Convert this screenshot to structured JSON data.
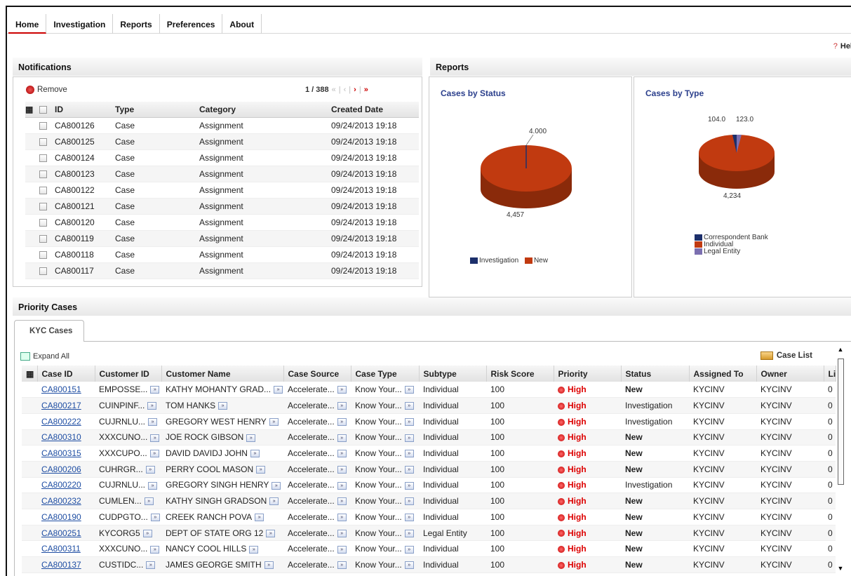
{
  "nav": {
    "tabs": [
      "Home",
      "Investigation",
      "Reports",
      "Preferences",
      "About"
    ],
    "help": "Hel"
  },
  "notifications": {
    "title": "Notifications",
    "remove_label": "Remove",
    "pager": "1 / 388",
    "columns": [
      "ID",
      "Type",
      "Category",
      "Created Date"
    ],
    "rows": [
      [
        "CA800126",
        "Case",
        "Assignment",
        "09/24/2013 19:18"
      ],
      [
        "CA800125",
        "Case",
        "Assignment",
        "09/24/2013 19:18"
      ],
      [
        "CA800124",
        "Case",
        "Assignment",
        "09/24/2013 19:18"
      ],
      [
        "CA800123",
        "Case",
        "Assignment",
        "09/24/2013 19:18"
      ],
      [
        "CA800122",
        "Case",
        "Assignment",
        "09/24/2013 19:18"
      ],
      [
        "CA800121",
        "Case",
        "Assignment",
        "09/24/2013 19:18"
      ],
      [
        "CA800120",
        "Case",
        "Assignment",
        "09/24/2013 19:18"
      ],
      [
        "CA800119",
        "Case",
        "Assignment",
        "09/24/2013 19:18"
      ],
      [
        "CA800118",
        "Case",
        "Assignment",
        "09/24/2013 19:18"
      ],
      [
        "CA800117",
        "Case",
        "Assignment",
        "09/24/2013 19:18"
      ]
    ]
  },
  "reports": {
    "title": "Reports",
    "status_chart": {
      "title": "Cases by Status",
      "labels": [
        "4.000",
        "4,457"
      ],
      "legend": [
        "Investigation",
        "New"
      ]
    },
    "type_chart": {
      "title": "Cases by Type",
      "labels": [
        "104.0",
        "123.0",
        "4,234"
      ],
      "legend": [
        "Correspondent Bank",
        "Individual",
        "Legal Entity"
      ]
    }
  },
  "chart_data": [
    {
      "type": "pie",
      "title": "Cases by Status",
      "categories": [
        "Investigation",
        "New"
      ],
      "values": [
        4,
        4457
      ],
      "colors": [
        "#1c2f6b",
        "#c13a10"
      ],
      "legend": "bottom"
    },
    {
      "type": "pie",
      "title": "Cases by Type",
      "categories": [
        "Correspondent Bank",
        "Individual",
        "Legal Entity"
      ],
      "values": [
        104,
        4234,
        123
      ],
      "colors": [
        "#1c2f6b",
        "#c13a10",
        "#7b6fb0"
      ],
      "legend": "bottom"
    }
  ],
  "priority": {
    "title": "Priority Cases",
    "tab": "KYC Cases",
    "expand_all": "Expand All",
    "case_list": "Case List",
    "columns": [
      "Case ID",
      "Customer ID",
      "Customer Name",
      "Case Source",
      "Case Type",
      "Subtype",
      "Risk Score",
      "Priority",
      "Status",
      "Assigned To",
      "Owner",
      "Li"
    ],
    "rows": [
      [
        "CA800151",
        "EMPOSSE...",
        "KATHY MOHANTY GRAD...",
        "Accelerate...",
        "Know Your...",
        "Individual",
        "100",
        "High",
        "New",
        "KYCINV",
        "KYCINV",
        "0"
      ],
      [
        "CA800217",
        "CUINPINF...",
        "TOM HANKS",
        "Accelerate...",
        "Know Your...",
        "Individual",
        "100",
        "High",
        "Investigation",
        "KYCINV",
        "KYCINV",
        "0"
      ],
      [
        "CA800222",
        "CUJRNLU...",
        "GREGORY WEST HENRY",
        "Accelerate...",
        "Know Your...",
        "Individual",
        "100",
        "High",
        "Investigation",
        "KYCINV",
        "KYCINV",
        "0"
      ],
      [
        "CA800310",
        "XXXCUNO...",
        "JOE ROCK GIBSON",
        "Accelerate...",
        "Know Your...",
        "Individual",
        "100",
        "High",
        "New",
        "KYCINV",
        "KYCINV",
        "0"
      ],
      [
        "CA800315",
        "XXXCUPO...",
        "DAVID DAVIDJ JOHN",
        "Accelerate...",
        "Know Your...",
        "Individual",
        "100",
        "High",
        "New",
        "KYCINV",
        "KYCINV",
        "0"
      ],
      [
        "CA800206",
        "CUHRGR...",
        "PERRY COOL MASON",
        "Accelerate...",
        "Know Your...",
        "Individual",
        "100",
        "High",
        "New",
        "KYCINV",
        "KYCINV",
        "0"
      ],
      [
        "CA800220",
        "CUJRNLU...",
        "GREGORY SINGH HENRY",
        "Accelerate...",
        "Know Your...",
        "Individual",
        "100",
        "High",
        "Investigation",
        "KYCINV",
        "KYCINV",
        "0"
      ],
      [
        "CA800232",
        "CUMLEN...",
        "KATHY SINGH GRADSON",
        "Accelerate...",
        "Know Your...",
        "Individual",
        "100",
        "High",
        "New",
        "KYCINV",
        "KYCINV",
        "0"
      ],
      [
        "CA800190",
        "CUDPGTO...",
        "CREEK RANCH POVA",
        "Accelerate...",
        "Know Your...",
        "Individual",
        "100",
        "High",
        "New",
        "KYCINV",
        "KYCINV",
        "0"
      ],
      [
        "CA800251",
        "KYCORG5",
        "DEPT OF STATE ORG 12",
        "Accelerate...",
        "Know Your...",
        "Legal Entity",
        "100",
        "High",
        "New",
        "KYCINV",
        "KYCINV",
        "0"
      ],
      [
        "CA800311",
        "XXXCUNO...",
        "NANCY COOL HILLS",
        "Accelerate...",
        "Know Your...",
        "Individual",
        "100",
        "High",
        "New",
        "KYCINV",
        "KYCINV",
        "0"
      ],
      [
        "CA800137",
        "CUSTIDC...",
        "JAMES GEORGE SMITH",
        "Accelerate...",
        "Know Your...",
        "Individual",
        "100",
        "High",
        "New",
        "KYCINV",
        "KYCINV",
        "0"
      ]
    ],
    "expandable_cols": [
      1,
      2,
      3,
      4
    ]
  }
}
